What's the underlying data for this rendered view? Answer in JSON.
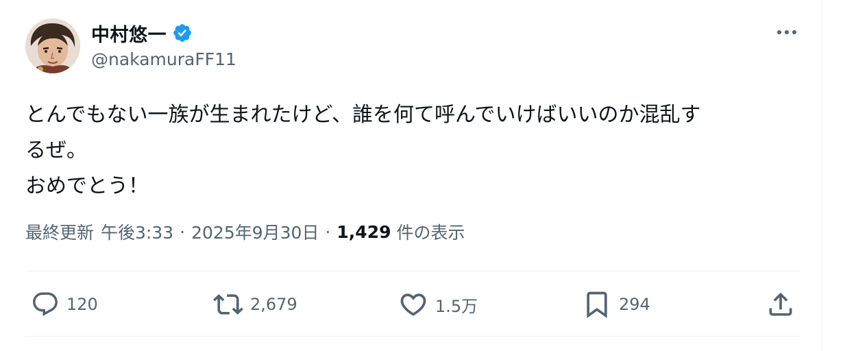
{
  "tweet": {
    "author": {
      "display_name": "中村悠一",
      "handle": "@nakamuraFF11",
      "verified_icon": "verified-badge-icon",
      "badge_color": "#1d9bf0"
    },
    "text": "とんでもない一族が生まれたけど、誰を何て呼んでいけばいいのか混乱す\nるぜ。\nおめでとう！",
    "meta": {
      "updated_label": "最終更新",
      "time": "午後3:33",
      "separator": "·",
      "date": "2025年9月30日",
      "views_count": "1,429",
      "views_label": "件の表示"
    },
    "actions": {
      "reply": {
        "icon": "reply-icon",
        "count": "120"
      },
      "retweet": {
        "icon": "retweet-icon",
        "count": "2,679"
      },
      "like": {
        "icon": "heart-icon",
        "count": "1.5万"
      },
      "bookmark": {
        "icon": "bookmark-icon",
        "count": "294"
      },
      "share": {
        "icon": "share-icon"
      }
    },
    "more_icon": "more-options-icon"
  },
  "colors": {
    "text_primary": "#0f1419",
    "text_secondary": "#536471",
    "divider": "#eff3f4",
    "verified_blue": "#1d9bf0"
  }
}
